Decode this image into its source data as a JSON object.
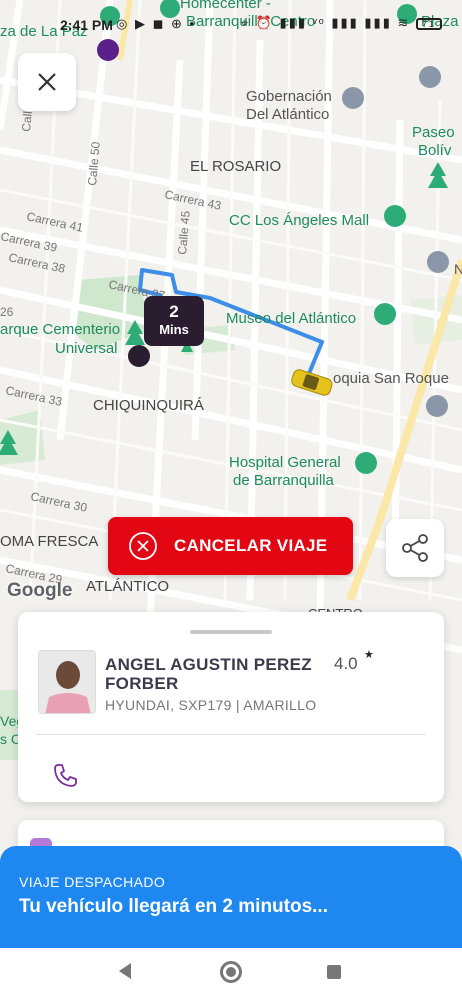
{
  "status_bar": {
    "time": "2:41 PM",
    "left_icons": "◎ ▶ ◼ ⊕ •",
    "right_icons": "⌖ ⏰ ▮▮▮ ᵛᵒ ▮▮▮ ▮▮▮ ≋",
    "battery": "71"
  },
  "map": {
    "place_labels": {
      "paz": "za de La Paz",
      "homecenter_1": "Homecenter -",
      "homecenter_2": "Barranquilla Centro",
      "plaza": "Plaza",
      "gobernacion_1": "Gobernación",
      "gobernacion_2": "Del Atlántico",
      "paseo_1": "Paseo",
      "paseo_2": "Bolív",
      "rosario": "EL ROSARIO",
      "los_angeles": "CC Los Ángeles Mall",
      "cementerio_1": "arque Cementerio",
      "cementerio_2": "Universal",
      "museo": "Museo del Atlántico",
      "parroquia": "oquia San Roque",
      "chiquinquira": "CHIQUINQUIRÁ",
      "hospital_1": "Hospital General",
      "hospital_2": "de Barranquilla",
      "loma": "OMA FRESCA",
      "atlantico": "ATLÁNTICO",
      "centro": "CENTRO",
      "n_label": "N",
      "vegas_1": "Veg",
      "vegas_2": "s C"
    },
    "street_labels": {
      "carrera_43": "Carrera 43",
      "carrera_41": "Carrera 41",
      "carrera_39": "Carrera 39",
      "carrera_38": "Carrera 38",
      "carrera_37": "Carrera 37",
      "carrera_33": "Carrera 33",
      "carrera_30": "Carrera 30",
      "carrera_29": "Carrera 29",
      "calle_50": "Calle 50",
      "calle_45": "Calle 45",
      "calle_top": "Calle",
      "calle_26": "26"
    },
    "google": "Google"
  },
  "eta": {
    "number": "2",
    "unit": "Mins"
  },
  "cancel_label": "CANCELAR VIAJE",
  "driver": {
    "name": "ANGEL AGUSTIN PEREZ FORBER",
    "rating": "4.0",
    "star": "★",
    "vehicle": "HYUNDAI, SXP179 | AMARILLO"
  },
  "banner": {
    "label": "VIAJE DESPACHADO",
    "message": "Tu vehículo llegará en 2 minutos..."
  },
  "colors": {
    "cancel": "#e30613",
    "banner": "#1e88f0",
    "route": "#3d8ee6",
    "accent_purple": "#7b2d9c"
  }
}
